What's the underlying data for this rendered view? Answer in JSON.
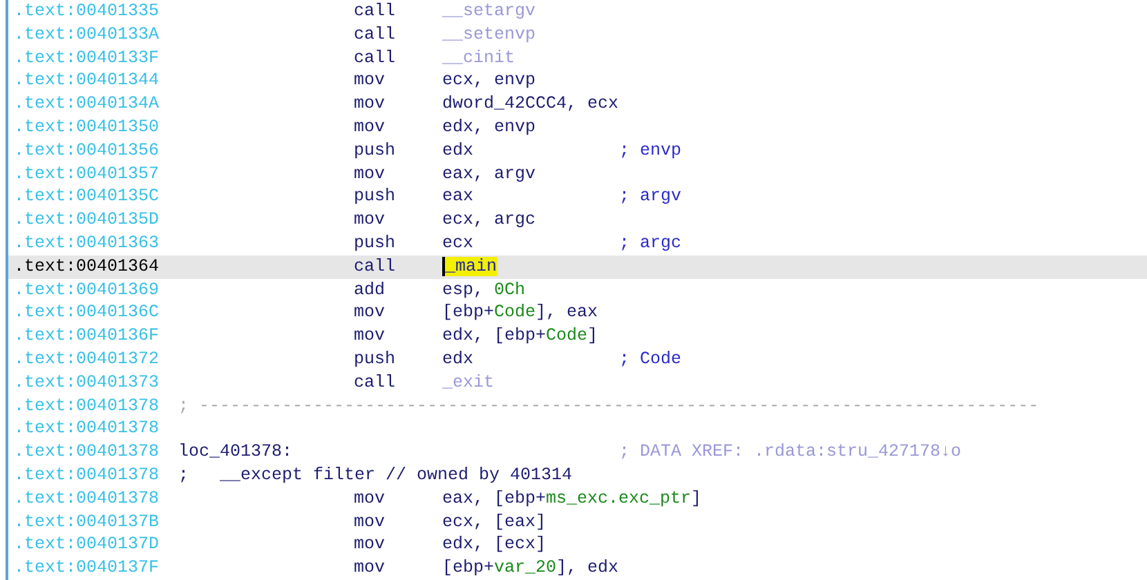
{
  "listing": {
    "rows": [
      {
        "kind": "instruction",
        "address": ".text:00401335",
        "selected": false,
        "mnemonic": "call",
        "operand": [
          {
            "kind": "import",
            "text": "__setargv"
          }
        ]
      },
      {
        "kind": "instruction",
        "address": ".text:0040133A",
        "selected": false,
        "mnemonic": "call",
        "operand": [
          {
            "kind": "import",
            "text": "__setenvp"
          }
        ]
      },
      {
        "kind": "instruction",
        "address": ".text:0040133F",
        "selected": false,
        "mnemonic": "call",
        "operand": [
          {
            "kind": "import",
            "text": "__cinit"
          }
        ]
      },
      {
        "kind": "instruction",
        "address": ".text:00401344",
        "selected": false,
        "mnemonic": "mov",
        "operand": [
          {
            "kind": "plain",
            "text": "ecx, envp"
          }
        ]
      },
      {
        "kind": "instruction",
        "address": ".text:0040134A",
        "selected": false,
        "mnemonic": "mov",
        "operand": [
          {
            "kind": "plain",
            "text": "dword_42CCC4, ecx"
          }
        ]
      },
      {
        "kind": "instruction",
        "address": ".text:00401350",
        "selected": false,
        "mnemonic": "mov",
        "operand": [
          {
            "kind": "plain",
            "text": "edx, envp"
          }
        ]
      },
      {
        "kind": "instruction",
        "address": ".text:00401356",
        "selected": false,
        "mnemonic": "push",
        "operand": [
          {
            "kind": "plain",
            "text": "edx"
          }
        ],
        "comment": "; envp"
      },
      {
        "kind": "instruction",
        "address": ".text:00401357",
        "selected": false,
        "mnemonic": "mov",
        "operand": [
          {
            "kind": "plain",
            "text": "eax, argv"
          }
        ]
      },
      {
        "kind": "instruction",
        "address": ".text:0040135C",
        "selected": false,
        "mnemonic": "push",
        "operand": [
          {
            "kind": "plain",
            "text": "eax"
          }
        ],
        "comment": "; argv"
      },
      {
        "kind": "instruction",
        "address": ".text:0040135D",
        "selected": false,
        "mnemonic": "mov",
        "operand": [
          {
            "kind": "plain",
            "text": "ecx, argc"
          }
        ]
      },
      {
        "kind": "instruction",
        "address": ".text:00401363",
        "selected": false,
        "mnemonic": "push",
        "operand": [
          {
            "kind": "plain",
            "text": "ecx"
          }
        ],
        "comment": "; argc"
      },
      {
        "kind": "instruction",
        "address": ".text:00401364",
        "selected": true,
        "mnemonic": "call",
        "operand": [
          {
            "kind": "highlighted",
            "text": "_main"
          }
        ]
      },
      {
        "kind": "instruction",
        "address": ".text:00401369",
        "selected": false,
        "mnemonic": "add",
        "operand": [
          {
            "kind": "plain",
            "text": "esp, "
          },
          {
            "kind": "number",
            "text": "0Ch"
          }
        ]
      },
      {
        "kind": "instruction",
        "address": ".text:0040136C",
        "selected": false,
        "mnemonic": "mov",
        "operand": [
          {
            "kind": "plain",
            "text": "[ebp+"
          },
          {
            "kind": "variable",
            "text": "Code"
          },
          {
            "kind": "plain",
            "text": "], eax"
          }
        ]
      },
      {
        "kind": "instruction",
        "address": ".text:0040136F",
        "selected": false,
        "mnemonic": "mov",
        "operand": [
          {
            "kind": "plain",
            "text": "edx, [ebp+"
          },
          {
            "kind": "variable",
            "text": "Code"
          },
          {
            "kind": "plain",
            "text": "]"
          }
        ]
      },
      {
        "kind": "instruction",
        "address": ".text:00401372",
        "selected": false,
        "mnemonic": "push",
        "operand": [
          {
            "kind": "plain",
            "text": "edx"
          }
        ],
        "comment": "; Code"
      },
      {
        "kind": "instruction",
        "address": ".text:00401373",
        "selected": false,
        "mnemonic": "call",
        "operand": [
          {
            "kind": "import",
            "text": "_exit"
          }
        ]
      },
      {
        "kind": "separator",
        "address": ".text:00401378",
        "selected": false,
        "text": "; ---------------------------------------------------------------------------------"
      },
      {
        "kind": "blank",
        "address": ".text:00401378",
        "selected": false
      },
      {
        "kind": "label",
        "address": ".text:00401378",
        "selected": false,
        "label": "loc_401378:",
        "comment": "; DATA XREF: .rdata:stru_427178↓o"
      },
      {
        "kind": "note",
        "address": ".text:00401378",
        "selected": false,
        "text": ";   __except filter // owned by 401314"
      },
      {
        "kind": "instruction",
        "address": ".text:00401378",
        "selected": false,
        "mnemonic": "mov",
        "operand": [
          {
            "kind": "plain",
            "text": "eax, [ebp+"
          },
          {
            "kind": "variable",
            "text": "ms_exc.exc_ptr"
          },
          {
            "kind": "plain",
            "text": "]"
          }
        ]
      },
      {
        "kind": "instruction",
        "address": ".text:0040137B",
        "selected": false,
        "mnemonic": "mov",
        "operand": [
          {
            "kind": "plain",
            "text": "ecx, [eax]"
          }
        ]
      },
      {
        "kind": "instruction",
        "address": ".text:0040137D",
        "selected": false,
        "mnemonic": "mov",
        "operand": [
          {
            "kind": "plain",
            "text": "edx, [ecx]"
          }
        ]
      },
      {
        "kind": "instruction",
        "address": ".text:0040137F",
        "selected": false,
        "mnemonic": "mov",
        "operand": [
          {
            "kind": "plain",
            "text": "[ebp+"
          },
          {
            "kind": "variable",
            "text": "var_20"
          },
          {
            "kind": "plain",
            "text": "], edx"
          }
        ]
      }
    ]
  }
}
